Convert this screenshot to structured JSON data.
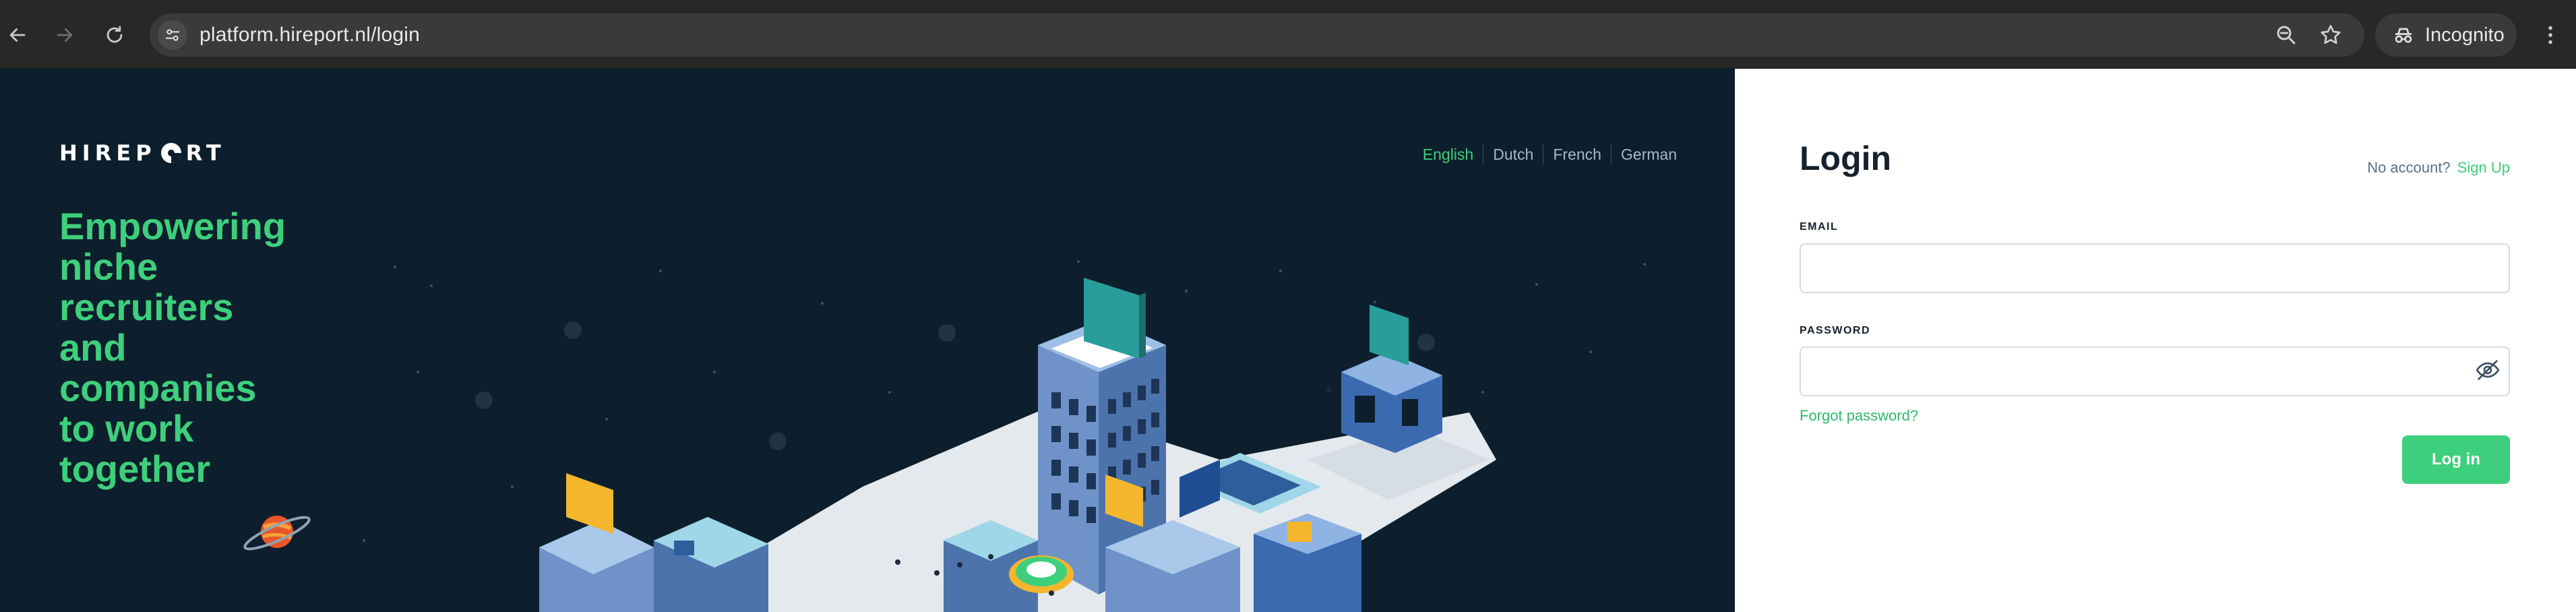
{
  "browser": {
    "url": "platform.hireport.nl/login",
    "profile_label": "Incognito"
  },
  "hero": {
    "logo_text_left": "HIREP",
    "logo_text_right": "RT",
    "languages": [
      {
        "label": "English",
        "active": true
      },
      {
        "label": "Dutch",
        "active": false
      },
      {
        "label": "French",
        "active": false
      },
      {
        "label": "German",
        "active": false
      }
    ],
    "tagline_lines": [
      "Empowering",
      "niche",
      "recruiters",
      "and",
      "companies",
      "to work",
      "together"
    ]
  },
  "login": {
    "title": "Login",
    "no_account_text": "No account?",
    "signup_label": "Sign Up",
    "email_label": "EMAIL",
    "email_value": "",
    "password_label": "PASSWORD",
    "password_value": "",
    "forgot_label": "Forgot password?",
    "submit_label": "Log in"
  },
  "colors": {
    "accent": "#3ecf7c",
    "hero_background": "#0d1f2c",
    "browser_chrome": "#282828"
  }
}
